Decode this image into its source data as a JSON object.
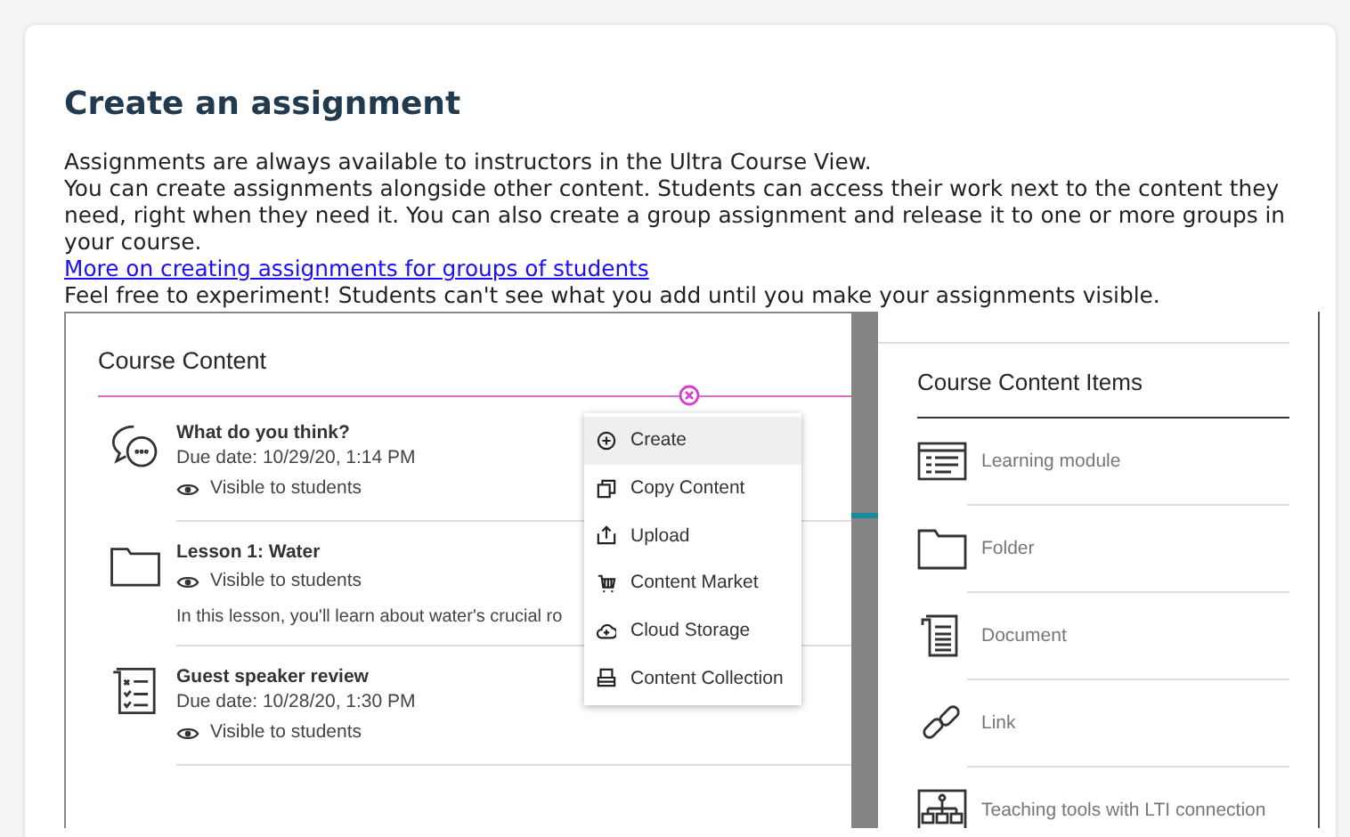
{
  "heading": "Create an assignment",
  "paragraphs": [
    "Assignments are always available to instructors in the Ultra Course View.",
    "You can create assignments alongside other content. Students can access their work next to the content they need, right when they need it. You can also create a group assignment and release it to one or more groups in your course."
  ],
  "link": "More on creating assignments for groups of students",
  "note": "Feel free to experiment! Students can't see what you add until you make your assignments visible.",
  "course_content": {
    "title": "Course Content",
    "items": [
      {
        "kind": "discussion",
        "title": "What do you think?",
        "due": "Due date: 10/29/20, 1:14 PM",
        "visibility": "Visible to students"
      },
      {
        "kind": "folder",
        "title": "Lesson 1: Water",
        "visibility": "Visible to students",
        "description": "In this lesson, you'll learn about water's crucial ro"
      },
      {
        "kind": "checklist",
        "title": "Guest speaker review",
        "due": "Due date: 10/28/20, 1:30 PM",
        "visibility": "Visible to students"
      }
    ]
  },
  "menu": [
    {
      "kind": "create",
      "label": "Create",
      "selected": true
    },
    {
      "kind": "copy",
      "label": "Copy Content",
      "selected": false
    },
    {
      "kind": "upload",
      "label": "Upload",
      "selected": false
    },
    {
      "kind": "market",
      "label": "Content Market",
      "selected": false
    },
    {
      "kind": "cloud",
      "label": "Cloud Storage",
      "selected": false
    },
    {
      "kind": "collection",
      "label": "Content Collection",
      "selected": false
    }
  ],
  "items_panel": {
    "title": "Course Content Items",
    "items": [
      {
        "kind": "module",
        "label": "Learning module"
      },
      {
        "kind": "folder",
        "label": "Folder"
      },
      {
        "kind": "document",
        "label": "Document"
      },
      {
        "kind": "link",
        "label": "Link"
      },
      {
        "kind": "lti",
        "label": "Teaching tools with LTI connection"
      }
    ]
  }
}
